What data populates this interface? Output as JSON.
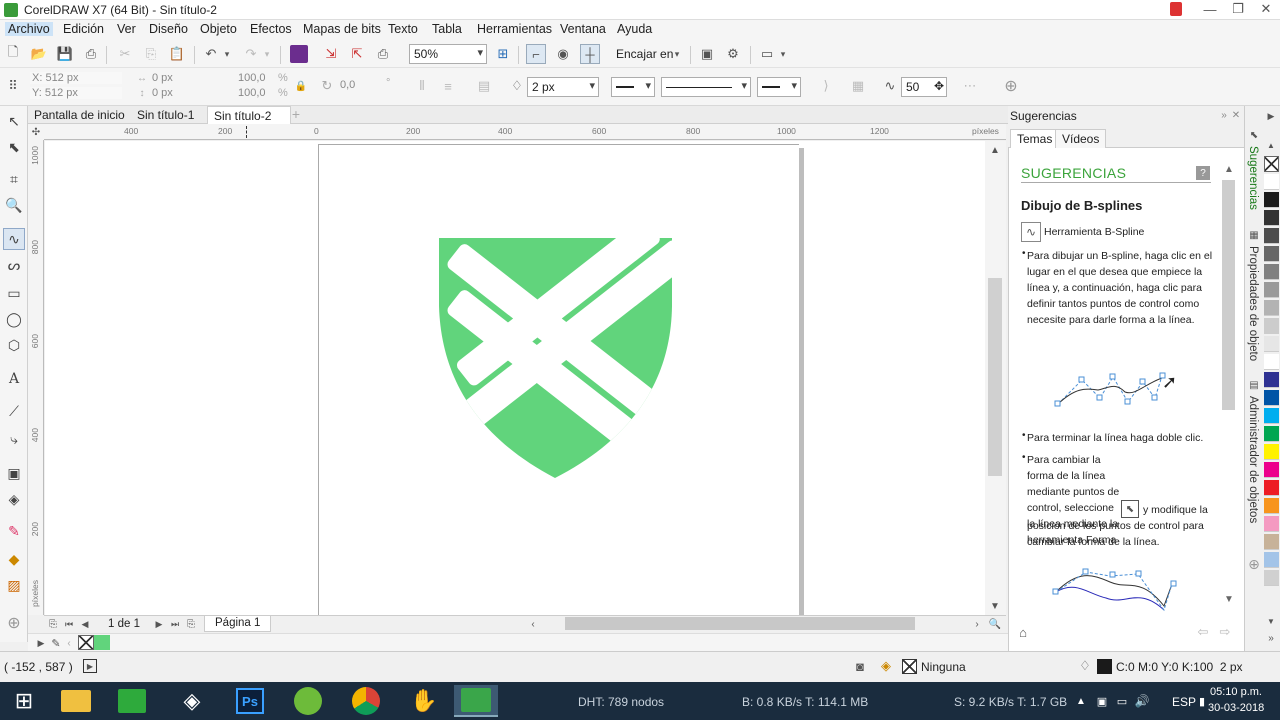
{
  "window": {
    "title": "CorelDRAW X7 (64 Bit) - Sin título-2"
  },
  "menu": [
    "Archivo",
    "Edición",
    "Ver",
    "Diseño",
    "Objeto",
    "Efectos",
    "Mapas de bits",
    "Texto",
    "Tabla",
    "Herramientas",
    "Ventana",
    "Ayuda"
  ],
  "std_toolbar": {
    "zoom": "50%",
    "snap_label": "Encajar en"
  },
  "prop_bar": {
    "x": "X: 512 px",
    "y": "Y: 512 px",
    "w": "0 px",
    "h": "0 px",
    "scale_x": "100,0",
    "scale_y": "100,0",
    "pct": "%",
    "angle": "0,0",
    "deg": "°",
    "outline_width": "2 px",
    "smoothing": "50"
  },
  "doc_tabs": [
    "Pantalla de inicio",
    "Sin título-1",
    "Sin título-2"
  ],
  "ruler": {
    "h_labels": [
      "400",
      "200",
      "0",
      "200",
      "400",
      "600",
      "800",
      "1000",
      "1200"
    ],
    "unit": "píxeles",
    "v_labels": [
      "1000",
      "800",
      "600",
      "400",
      "200"
    ]
  },
  "page_nav": {
    "count": "1 de 1",
    "page": "Página 1"
  },
  "status": {
    "coords": "( -152 , 587 )",
    "fill_label": "Ninguna",
    "outline_label": "C:0 M:0 Y:0 K:100  2 px"
  },
  "docker": {
    "title": "Sugerencias",
    "tabs": [
      "Temas",
      "Vídeos"
    ],
    "heading": "SUGERENCIAS",
    "subheading": "Dibujo de B-splines",
    "tool_name": "Herramienta B-Spline",
    "para1": "Para dibujar un B-spline, haga clic en el lugar en el que desea que empiece la línea y, a continuación, haga clic para definir tantos puntos de control como necesite para darle forma a la línea.",
    "para2": "Para terminar la línea haga doble clic.",
    "para3a": "Para cambiar la forma de la línea mediante puntos de control, seleccione la línea mediante la herramienta Forma",
    "para3b": "y modifique la posición de los puntos de control para cambiar la forma de la línea."
  },
  "side_tabs": [
    "Sugerencias",
    "Propiedades de objeto",
    "Administrador de objetos"
  ],
  "palette": [
    "#ffffff",
    "#1a1a1a",
    "#333333",
    "#4d4d4d",
    "#666666",
    "#808080",
    "#999999",
    "#b3b3b3",
    "#cccccc",
    "#e6e6e6",
    "#ffffff",
    "#2e3192",
    "#0054a6",
    "#00aeef",
    "#00a651",
    "#fff200",
    "#ec008c",
    "#ed1c24",
    "#f7941d",
    "#f49ac1",
    "#c7b299",
    "#a3c4e8",
    "#d0d0d0"
  ],
  "shape_color": "#61d47c",
  "taskbar": {
    "dht": "DHT: 789 nodos",
    "bytes": "B: 0.8 KB/s T: 114.1 MB",
    "speed": "S: 9.2 KB/s T: 1.7 GB",
    "lang": "ESP",
    "time": "05:10 p.m.",
    "date": "30-03-2018"
  }
}
